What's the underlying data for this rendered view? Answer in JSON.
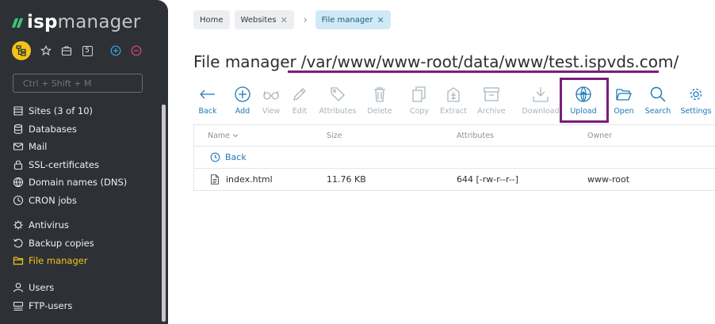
{
  "app": {
    "logo_isp": "isp",
    "logo_manager": "manager",
    "quick_badge": "5",
    "search_placeholder": "Ctrl + Shift + M"
  },
  "sidebar": {
    "groups": [
      [
        {
          "label": "Sites (3 of 10)",
          "icon": "sites-icon"
        },
        {
          "label": "Databases",
          "icon": "database-icon"
        },
        {
          "label": "Mail",
          "icon": "mail-icon"
        },
        {
          "label": "SSL-certificates",
          "icon": "ssl-icon"
        },
        {
          "label": "Domain names (DNS)",
          "icon": "globe-icon"
        },
        {
          "label": "CRON jobs",
          "icon": "clock-icon"
        }
      ],
      [
        {
          "label": "Antivirus",
          "icon": "antivirus-icon"
        },
        {
          "label": "Backup copies",
          "icon": "backup-icon"
        },
        {
          "label": "File manager",
          "icon": "folder-icon",
          "active": true
        }
      ],
      [
        {
          "label": "Users",
          "icon": "user-icon"
        },
        {
          "label": "FTP-users",
          "icon": "ftp-icon"
        }
      ]
    ]
  },
  "breadcrumbs": [
    {
      "label": "Home",
      "closable": false
    },
    {
      "label": "Websites",
      "closable": true
    },
    {
      "label": "File manager",
      "closable": true,
      "active": true
    }
  ],
  "page": {
    "title": "File manager",
    "path": "/var/www/www-root/data/www/test.ispvds.com/"
  },
  "toolbar": [
    {
      "label": "Back",
      "icon": "back-arrow-icon",
      "enabled": true
    },
    {
      "label": "Add",
      "icon": "add-icon",
      "enabled": true
    },
    {
      "label": "View",
      "icon": "glasses-icon",
      "enabled": false
    },
    {
      "label": "Edit",
      "icon": "pencil-icon",
      "enabled": false
    },
    {
      "label": "Attributes",
      "icon": "tag-icon",
      "enabled": false
    },
    {
      "label": "Delete",
      "icon": "trash-icon",
      "enabled": false
    },
    {
      "label": "Copy",
      "icon": "copy-icon",
      "enabled": false
    },
    {
      "label": "Extract",
      "icon": "extract-icon",
      "enabled": false
    },
    {
      "label": "Archive",
      "icon": "archive-icon",
      "enabled": false
    },
    {
      "label": "Download",
      "icon": "download-icon",
      "enabled": false
    },
    {
      "label": "Upload",
      "icon": "upload-icon",
      "enabled": true
    },
    {
      "label": "Open",
      "icon": "folder-open-icon",
      "enabled": true
    },
    {
      "label": "Search",
      "icon": "search-icon",
      "enabled": true
    },
    {
      "label": "Settings",
      "icon": "gear-icon",
      "enabled": true
    }
  ],
  "table": {
    "columns": [
      "Name",
      "Size",
      "Attributes",
      "Owner"
    ],
    "back_label": "Back",
    "rows": [
      {
        "name": "index.html",
        "size": "11.76 KB",
        "attributes": "644 [-rw-r--r--]",
        "owner": "www-root"
      }
    ]
  },
  "colors": {
    "sidebar_bg": "#2d3035",
    "accent_yellow": "#f2c318",
    "link_blue": "#1c79b7",
    "highlight_purple": "#7b1c7f"
  }
}
